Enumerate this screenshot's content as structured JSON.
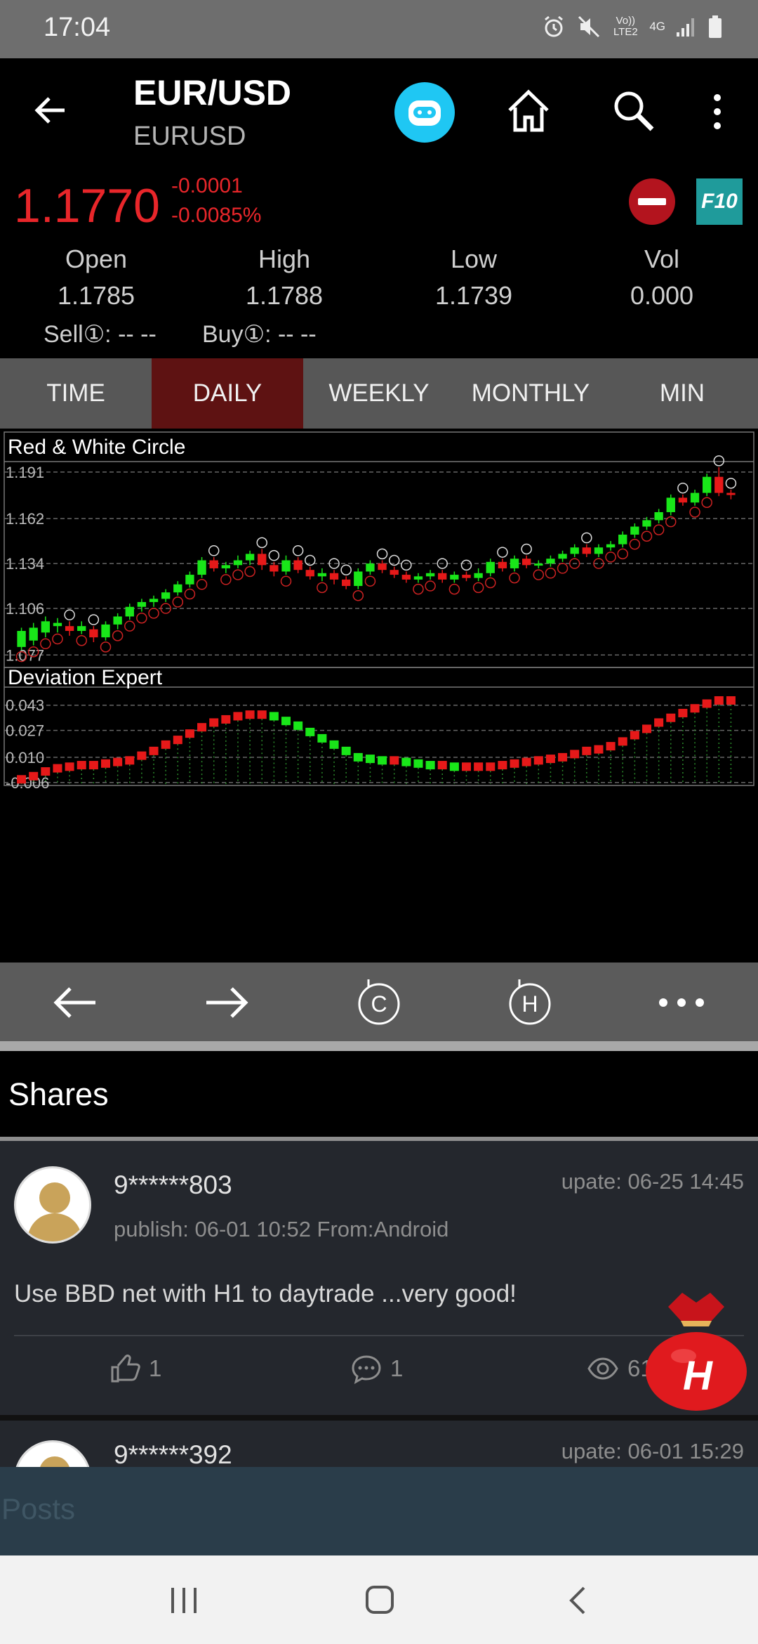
{
  "status_bar": {
    "time": "17:04",
    "network": "Vo)) LTE2",
    "net_type": "4G"
  },
  "header": {
    "title": "EUR/USD",
    "subtitle": "EURUSD"
  },
  "quote": {
    "price": "1.1770",
    "change_abs": "-0.0001",
    "change_pct": "-0.0085%",
    "f10_label": "F10",
    "stats": [
      {
        "label": "Open",
        "value": "1.1785"
      },
      {
        "label": "High",
        "value": "1.1788"
      },
      {
        "label": "Low",
        "value": "1.1739"
      },
      {
        "label": "Vol",
        "value": "0.000"
      }
    ],
    "sell": "Sell①:  --   --",
    "buy": "Buy①:  --   --"
  },
  "tabs": [
    "TIME",
    "DAILY",
    "WEEKLY",
    "MONTHLY",
    "MIN"
  ],
  "active_tab": "DAILY",
  "colors": {
    "up": "#19e619",
    "down": "#e61919",
    "price_red": "#e8262a",
    "tab_active": "#5e1212"
  },
  "chart_data": [
    {
      "type": "candlestick",
      "title": "Red & White Circle",
      "y_ticks": [
        "1.191",
        "1.162",
        "1.134",
        "1.106",
        "1.077"
      ],
      "ylim": [
        1.071,
        1.194
      ],
      "candles": [
        [
          1.082,
          1.092,
          1.08,
          1.094
        ],
        [
          1.086,
          1.094,
          1.083,
          1.097
        ],
        [
          1.091,
          1.098,
          1.088,
          1.101
        ],
        [
          1.095,
          1.097,
          1.091,
          1.1
        ],
        [
          1.095,
          1.092,
          1.089,
          1.098
        ],
        [
          1.092,
          1.095,
          1.09,
          1.098
        ],
        [
          1.093,
          1.088,
          1.085,
          1.095
        ],
        [
          1.088,
          1.096,
          1.086,
          1.098
        ],
        [
          1.096,
          1.101,
          1.093,
          1.103
        ],
        [
          1.101,
          1.107,
          1.099,
          1.109
        ],
        [
          1.107,
          1.11,
          1.104,
          1.112
        ],
        [
          1.11,
          1.112,
          1.107,
          1.114
        ],
        [
          1.112,
          1.116,
          1.11,
          1.118
        ],
        [
          1.116,
          1.121,
          1.114,
          1.123
        ],
        [
          1.121,
          1.127,
          1.119,
          1.129
        ],
        [
          1.127,
          1.136,
          1.125,
          1.138
        ],
        [
          1.136,
          1.131,
          1.129,
          1.138
        ],
        [
          1.131,
          1.133,
          1.128,
          1.135
        ],
        [
          1.133,
          1.136,
          1.131,
          1.139
        ],
        [
          1.136,
          1.14,
          1.133,
          1.142
        ],
        [
          1.14,
          1.133,
          1.13,
          1.143
        ],
        [
          1.133,
          1.129,
          1.126,
          1.135
        ],
        [
          1.129,
          1.136,
          1.127,
          1.139
        ],
        [
          1.136,
          1.13,
          1.128,
          1.138
        ],
        [
          1.13,
          1.126,
          1.124,
          1.132
        ],
        [
          1.126,
          1.128,
          1.123,
          1.131
        ],
        [
          1.128,
          1.124,
          1.121,
          1.13
        ],
        [
          1.124,
          1.12,
          1.118,
          1.126
        ],
        [
          1.12,
          1.129,
          1.118,
          1.131
        ],
        [
          1.129,
          1.134,
          1.127,
          1.136
        ],
        [
          1.134,
          1.13,
          1.128,
          1.136
        ],
        [
          1.13,
          1.127,
          1.125,
          1.132
        ],
        [
          1.127,
          1.124,
          1.122,
          1.129
        ],
        [
          1.124,
          1.126,
          1.122,
          1.128
        ],
        [
          1.126,
          1.128,
          1.124,
          1.13
        ],
        [
          1.128,
          1.124,
          1.122,
          1.13
        ],
        [
          1.124,
          1.127,
          1.122,
          1.129
        ],
        [
          1.127,
          1.125,
          1.123,
          1.129
        ],
        [
          1.125,
          1.128,
          1.123,
          1.131
        ],
        [
          1.128,
          1.135,
          1.126,
          1.137
        ],
        [
          1.135,
          1.131,
          1.129,
          1.137
        ],
        [
          1.131,
          1.137,
          1.129,
          1.139
        ],
        [
          1.137,
          1.133,
          1.131,
          1.139
        ],
        [
          1.133,
          1.134,
          1.131,
          1.136
        ],
        [
          1.134,
          1.137,
          1.132,
          1.139
        ],
        [
          1.137,
          1.14,
          1.135,
          1.142
        ],
        [
          1.14,
          1.144,
          1.138,
          1.146
        ],
        [
          1.144,
          1.14,
          1.138,
          1.146
        ],
        [
          1.14,
          1.144,
          1.138,
          1.146
        ],
        [
          1.144,
          1.146,
          1.142,
          1.148
        ],
        [
          1.146,
          1.152,
          1.144,
          1.154
        ],
        [
          1.152,
          1.157,
          1.15,
          1.159
        ],
        [
          1.157,
          1.161,
          1.155,
          1.163
        ],
        [
          1.161,
          1.166,
          1.159,
          1.168
        ],
        [
          1.166,
          1.175,
          1.164,
          1.177
        ],
        [
          1.175,
          1.172,
          1.17,
          1.177
        ],
        [
          1.172,
          1.178,
          1.17,
          1.18
        ],
        [
          1.178,
          1.188,
          1.176,
          1.19
        ],
        [
          1.188,
          1.178,
          1.176,
          1.194
        ],
        [
          1.178,
          1.177,
          1.174,
          1.18
        ]
      ]
    },
    {
      "type": "bar",
      "title": "Deviation Expert",
      "y_ticks": [
        "0.043",
        "0.027",
        "0.010",
        "-0.006"
      ],
      "ylim": [
        -0.007,
        0.05
      ],
      "values": [
        -0.004,
        -0.002,
        0.001,
        0.003,
        0.004,
        0.005,
        0.005,
        0.006,
        0.007,
        0.008,
        0.011,
        0.014,
        0.018,
        0.021,
        0.025,
        0.029,
        0.032,
        0.034,
        0.036,
        0.037,
        0.037,
        0.036,
        0.033,
        0.03,
        0.026,
        0.022,
        0.018,
        0.014,
        0.01,
        0.009,
        0.008,
        0.008,
        0.007,
        0.006,
        0.005,
        0.005,
        0.004,
        0.004,
        0.004,
        0.004,
        0.005,
        0.006,
        0.007,
        0.008,
        0.009,
        0.01,
        0.012,
        0.014,
        0.015,
        0.017,
        0.02,
        0.024,
        0.028,
        0.032,
        0.035,
        0.038,
        0.041,
        0.044,
        0.046,
        0.046
      ]
    }
  ],
  "shares": {
    "title": "Shares",
    "posts": [
      {
        "user": "9******803",
        "update": "upate: 06-25 14:45",
        "publish": "publish: 06-01 10:52   From:Android",
        "content": "Use BBD net  with H1 to daytrade ...very good!",
        "likes": "1",
        "comments": "1",
        "views": "61"
      },
      {
        "user": "9******392",
        "update": "upate: 06-01 15:29"
      }
    ]
  },
  "posts_label": "Posts",
  "redbag_label": "H"
}
